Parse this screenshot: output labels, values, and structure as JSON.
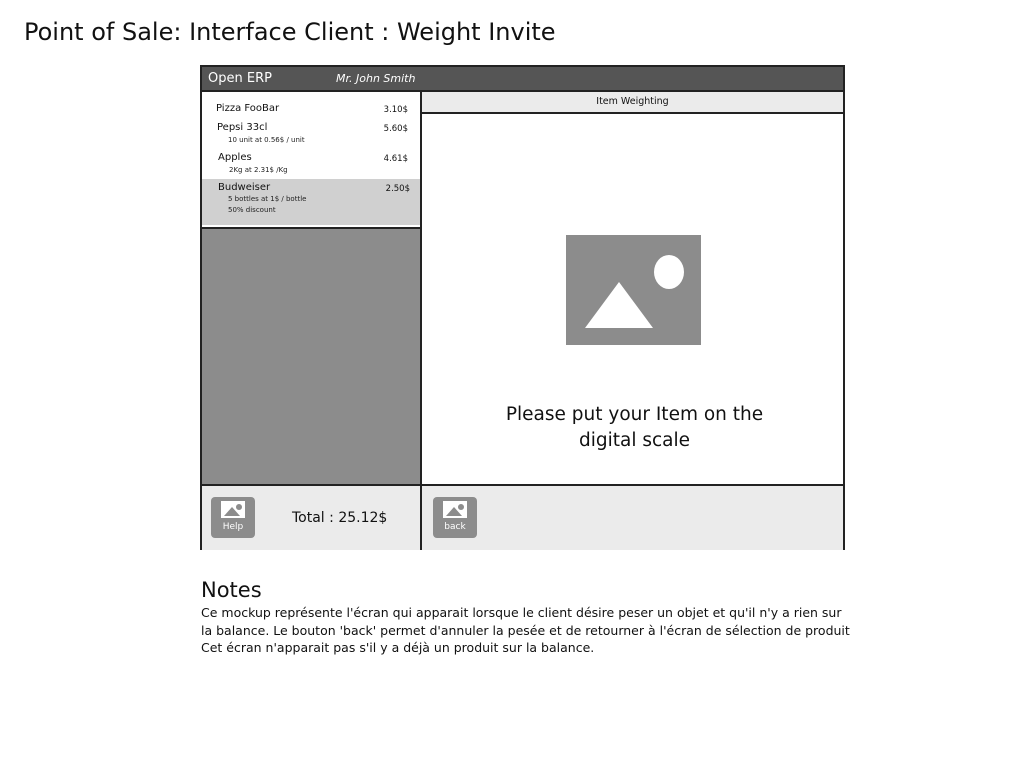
{
  "page": {
    "title": "Point of Sale: Interface Client : Weight Invite"
  },
  "topbar": {
    "brand": "Open ERP",
    "user": "Mr. John Smith"
  },
  "order": {
    "items": [
      {
        "name": "Pizza FooBar",
        "price": "3.10$",
        "details": []
      },
      {
        "name": "Pepsi 33cl",
        "price": "5.60$",
        "details": [
          "10 unit at 0.56$ / unit"
        ]
      },
      {
        "name": "Apples",
        "price": "4.61$",
        "details": [
          "2Kg at 2.31$ /Kg"
        ]
      },
      {
        "name": "Budweiser",
        "price": "2.50$",
        "details": [
          "5 bottles at 1$ / bottle",
          "50% discount"
        ],
        "selected": true
      }
    ],
    "total": "Total : 25.12$"
  },
  "buttons": {
    "help": "Help",
    "back": "back"
  },
  "panel": {
    "title": "Item Weighting",
    "instruction_line1": "Please put your Item on the",
    "instruction_line2": "digital scale"
  },
  "notes": {
    "title": "Notes",
    "lines": [
      "Ce mockup représente l'écran qui apparait lorsque le client désire peser un objet et qu'il n'y a rien sur",
      "la balance. Le bouton 'back' permet d'annuler la pesée et de retourner à l'écran de sélection de produit",
      "Cet écran n'apparait pas s'il y a déjà un produit sur la balance."
    ]
  },
  "colors": {
    "topbar": "#555555",
    "panel_gray": "#8c8c8c",
    "light_gray": "#ebebeb",
    "selected_row": "#d0d0d0"
  },
  "icons": {
    "help_button": "image-placeholder-icon",
    "back_button": "image-placeholder-icon",
    "scale_area": "image-placeholder"
  }
}
